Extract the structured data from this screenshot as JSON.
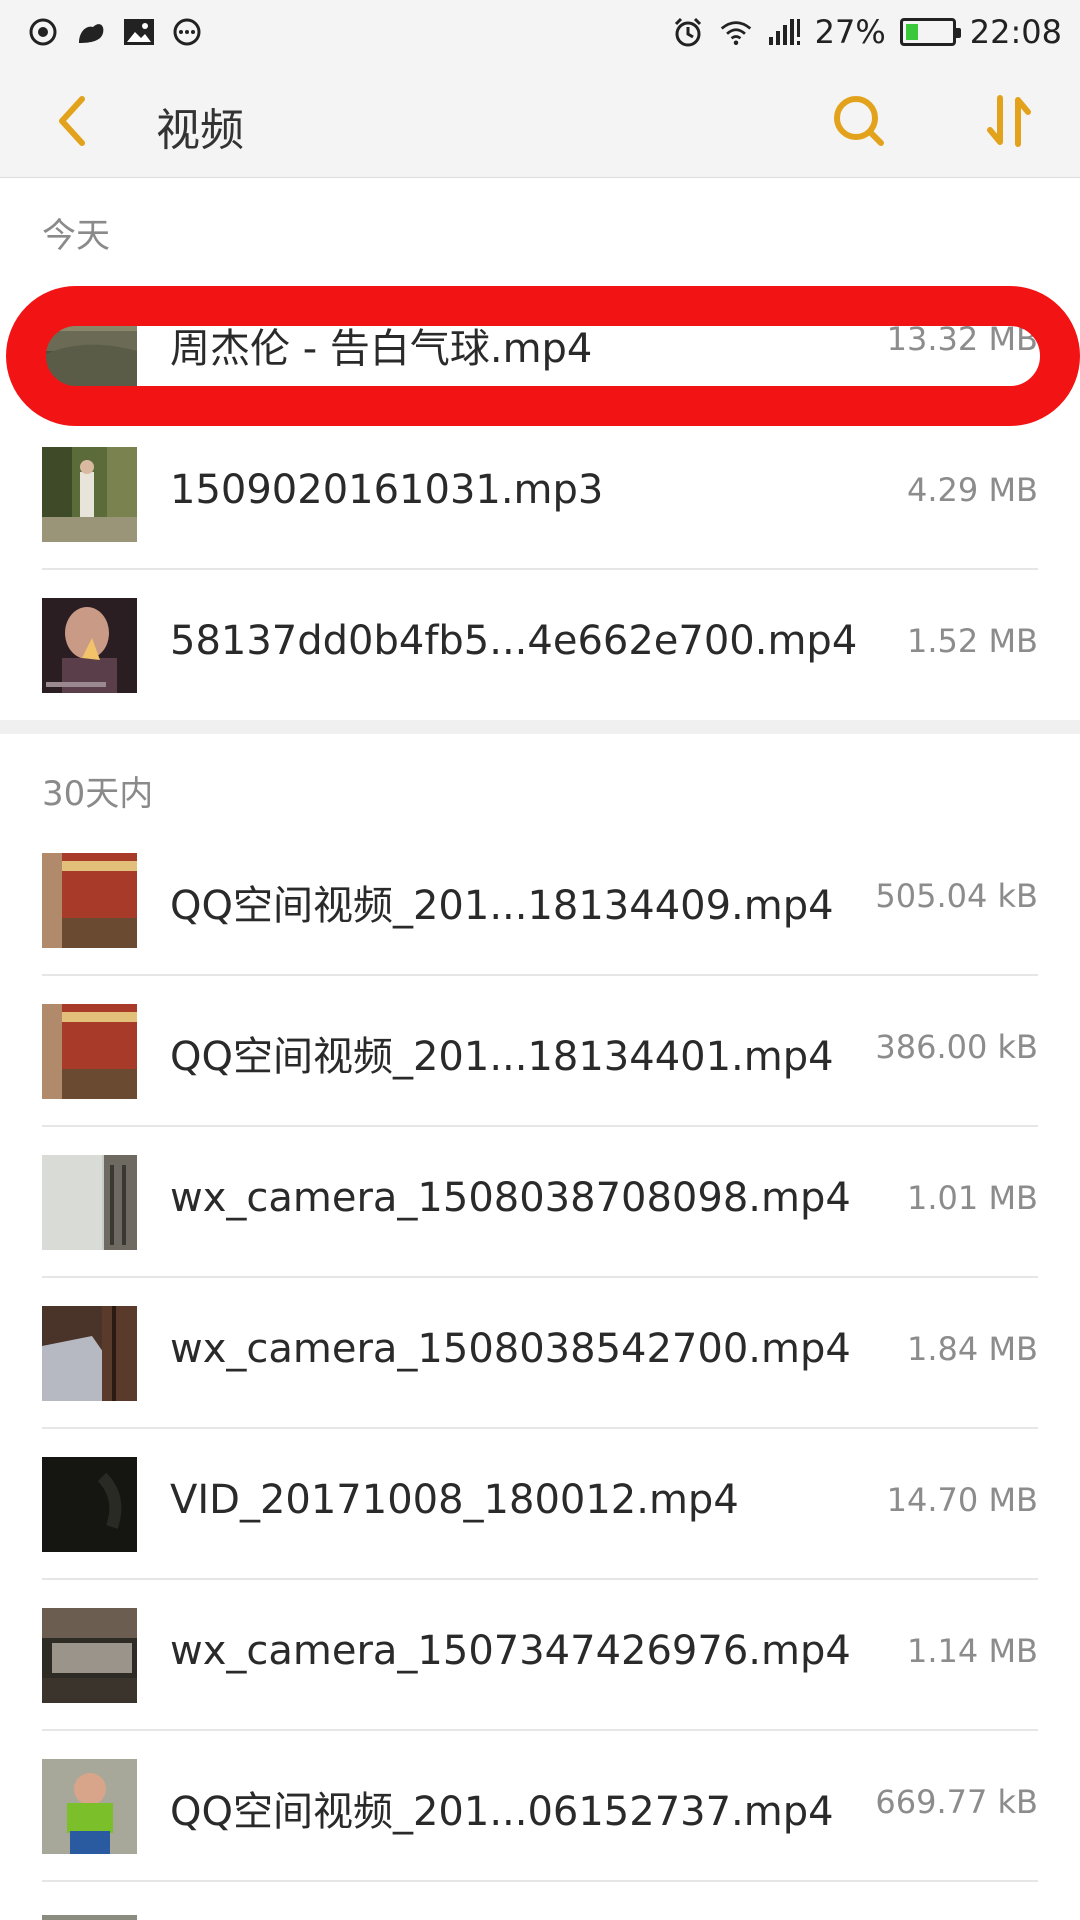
{
  "status_bar": {
    "battery_percent": "27%",
    "battery_level": 0.27,
    "time": "22:08",
    "left_icons": [
      "weibo-icon",
      "squirrel-app-icon",
      "gallery-icon",
      "more-dots-icon"
    ],
    "right_icons": [
      "alarm-icon",
      "wifi-icon",
      "signal-icon",
      "battery-icon"
    ]
  },
  "header": {
    "title": "视频",
    "back_icon": "chevron-left-icon",
    "search_icon": "search-icon",
    "sort_icon": "sort-icon",
    "accent_color": "#e3a21c"
  },
  "sections": [
    {
      "label": "今天",
      "items": [
        {
          "name": "周杰伦 - 告白气球.mp4",
          "size": "13.32 MB"
        },
        {
          "name": "1509020161031.mp3",
          "size": "4.29 MB"
        },
        {
          "name": "58137dd0b4fb5...4e662e700.mp4",
          "size": "1.52 MB"
        }
      ]
    },
    {
      "label": "30天内",
      "items": [
        {
          "name": "QQ空间视频_201...18134409.mp4",
          "size": "505.04 kB"
        },
        {
          "name": "QQ空间视频_201...18134401.mp4",
          "size": "386.00 kB"
        },
        {
          "name": "wx_camera_1508038708098.mp4",
          "size": "1.01 MB"
        },
        {
          "name": "wx_camera_1508038542700.mp4",
          "size": "1.84 MB"
        },
        {
          "name": "VID_20171008_180012.mp4",
          "size": "14.70 MB"
        },
        {
          "name": "wx_camera_1507347426976.mp4",
          "size": "1.14 MB"
        },
        {
          "name": "QQ空间视频_201...06152737.mp4",
          "size": "669.77 kB"
        }
      ]
    }
  ],
  "highlight_color": "#f21414"
}
